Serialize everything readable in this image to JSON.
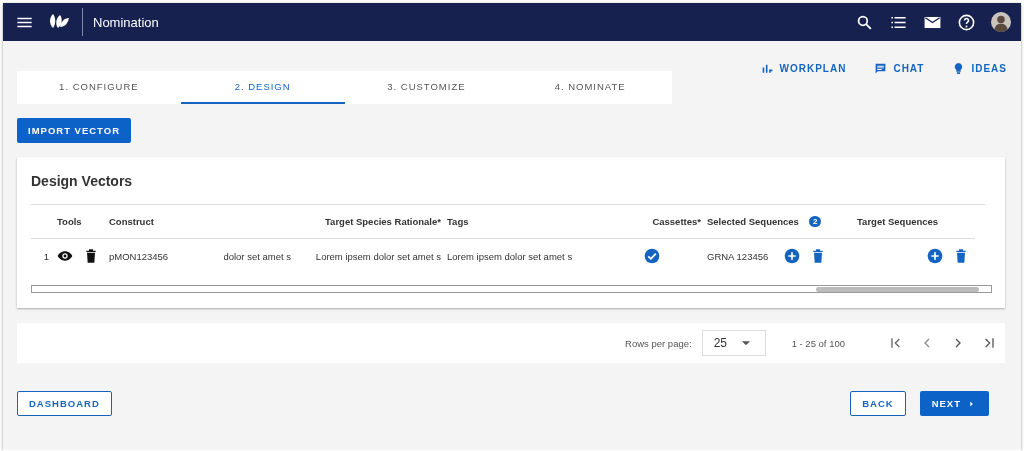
{
  "header": {
    "title": "Nomination"
  },
  "steps": [
    {
      "label": "1. CONFIGURE",
      "selected": false
    },
    {
      "label": "2. DESIGN",
      "selected": true
    },
    {
      "label": "3. CUSTOMIZE",
      "selected": false
    },
    {
      "label": "4. NOMINATE",
      "selected": false
    }
  ],
  "top_links": [
    {
      "kind": "workplan",
      "label": "WORKPLAN"
    },
    {
      "kind": "chat",
      "label": "CHAT"
    },
    {
      "kind": "ideas",
      "label": "IDEAS"
    }
  ],
  "import_button": "IMPORT VECTOR",
  "card": {
    "title": "Design Vectors",
    "columns": [
      {
        "kind": "index"
      },
      {
        "kind": "text",
        "label": "Tools"
      },
      {
        "kind": "text",
        "label": "Construct"
      },
      {
        "kind": "text"
      },
      {
        "kind": "right",
        "label": "Target Species Rationale*"
      },
      {
        "kind": "text",
        "label": "Tags"
      },
      {
        "kind": "right",
        "label": "Cassettes*"
      },
      {
        "kind": "text",
        "label": "Selected Sequences",
        "badge": "2"
      },
      {
        "kind": "text",
        "label": "Target Sequences"
      }
    ],
    "rows": [
      {
        "index": "1",
        "construct": "pMON123456",
        "column_4": "dolor set amet s",
        "rationale": "Lorem ipsem dolor set amet s",
        "tags": "Lorem ipsem dolor set amet s",
        "cassettes_checked": true,
        "selected_sequence": "GRNA 123456"
      }
    ]
  },
  "pagination": {
    "rows_label": "Rows per page:",
    "rows_value": "25",
    "range": "1 - 25 of 100"
  },
  "buttons": {
    "dashboard": "DASHBOARD",
    "back": "BACK",
    "next": "NEXT"
  }
}
